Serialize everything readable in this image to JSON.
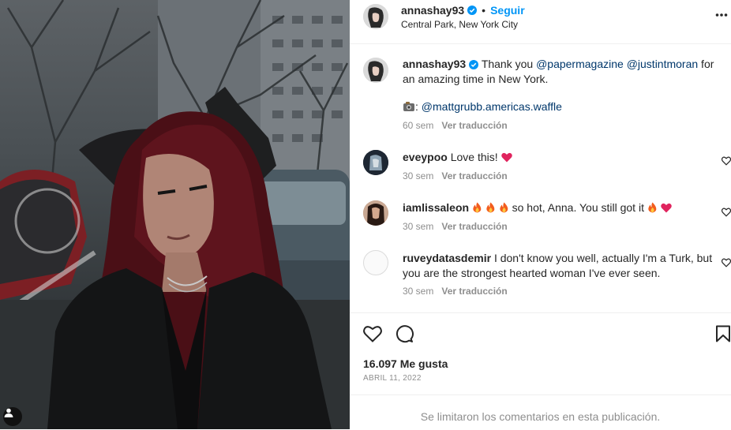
{
  "post": {
    "username": "annashay93",
    "separator": "•",
    "follow_label": "Seguir",
    "location": "Central Park, New York City"
  },
  "caption": {
    "username": "annashay93",
    "text_before": "Thank you ",
    "mention_1": "@papermagazine",
    "mention_2": "@justintmoran",
    "text_after": " for",
    "line2": "an amazing time in New York.",
    "credit_separator": ":",
    "credit_mention": "@mattgrubb.americas.waffle",
    "time": "60 sem",
    "translate": "Ver traducción"
  },
  "comments": [
    {
      "username": "eveypoo",
      "text": "Love this!",
      "time": "30 sem",
      "translate": "Ver traducción"
    },
    {
      "username": "iamlissaleon",
      "text": "so hot, Anna. You still got it",
      "time": "30 sem",
      "translate": "Ver traducción"
    },
    {
      "username": "ruveydatasdemir",
      "text_line1": "I don't know you well, actually I'm a Turk, but",
      "text_line2": "you are the strongest hearted woman I've ever seen.",
      "time": "30 sem",
      "translate": "Ver traducción"
    }
  ],
  "stats": {
    "likes": "16.097 Me gusta",
    "date": "ABRIL 11, 2022"
  },
  "footer": {
    "notice": "Se limitaron los comentarios en esta publicación."
  },
  "colors": {
    "link": "#0095f6",
    "mention": "#00376b",
    "muted": "#8e8e8e",
    "verified": "#0095f6"
  }
}
